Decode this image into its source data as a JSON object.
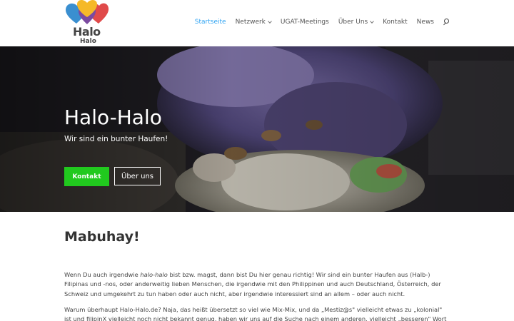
{
  "logo": {
    "word": "Halo",
    "word_small": "Halo",
    "colors": [
      "#f5b928",
      "#e04a4a",
      "#3a8fd0",
      "#7b4aa0"
    ]
  },
  "nav": {
    "items": [
      {
        "label": "Startseite",
        "active": true,
        "dropdown": false
      },
      {
        "label": "Netzwerk",
        "active": false,
        "dropdown": true
      },
      {
        "label": "UGAT-Meetings",
        "active": false,
        "dropdown": false
      },
      {
        "label": "Über Uns",
        "active": false,
        "dropdown": true
      },
      {
        "label": "Kontakt",
        "active": false,
        "dropdown": false
      },
      {
        "label": "News",
        "active": false,
        "dropdown": false
      }
    ],
    "search_icon": "search-icon",
    "active_color": "#2ea3f2"
  },
  "hero": {
    "title": "Halo-Halo",
    "subtitle": "Wir sind ein bunter Haufen!",
    "primary_button": "Kontakt",
    "secondary_button": "Über uns",
    "primary_color": "#21c91e"
  },
  "main": {
    "heading": "Mabuhay!",
    "para1_before": "Wenn Du auch irgendwie ",
    "para1_em": "halo-halo",
    "para1_after": " bist bzw. magst, dann bist Du hier genau richtig! Wir sind ein bunter Haufen aus (Halb-) Filipinas und -nos, oder anderweitig lieben Menschen, die irgendwie mit den Philippinen und auch Deutschland, Österreich, der Schweiz und umgekehrt zu tun haben oder auch nicht, aber irgendwie interessiert sind an allem – oder auch nicht.",
    "para2": "Warum überhaupt Halo-Halo.de? Naja, das heißt übersetzt so viel wie Mix-Mix, und da „Mestiz@s\" vielleicht etwas zu „kolonial\" ist und filipinX vielleicht noch nicht bekannt genug, haben wir uns auf die Suche nach einem anderen, vielleicht „besseren\" Wort gemacht, und sind beim"
  }
}
